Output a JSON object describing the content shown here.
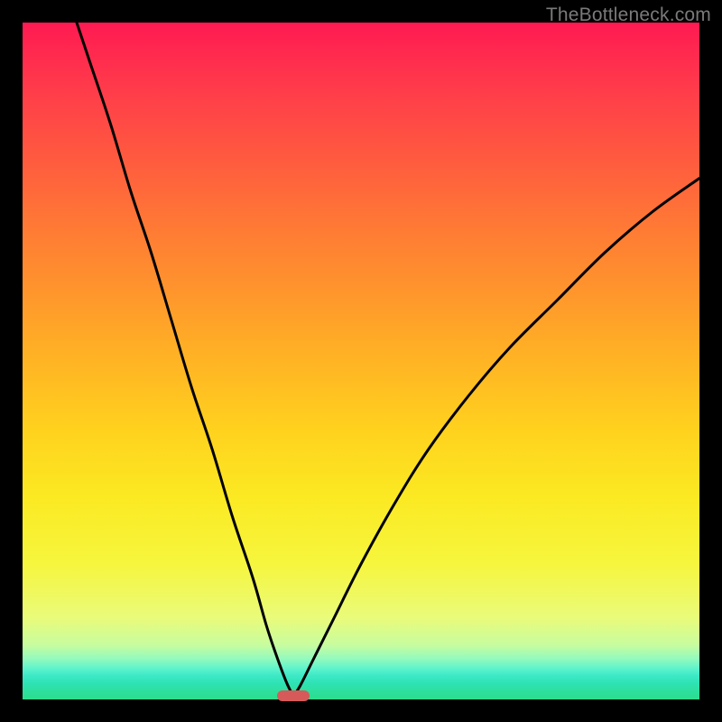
{
  "watermark": "TheBottleneck.com",
  "chart_data": {
    "type": "line",
    "title": "",
    "xlabel": "",
    "ylabel": "",
    "xlim": [
      0,
      100
    ],
    "ylim": [
      0,
      100
    ],
    "minimum_x": 40,
    "marker": {
      "x": 40,
      "y": 0.5,
      "color": "#d65a5a"
    },
    "series": [
      {
        "name": "left-branch",
        "x": [
          8,
          10,
          13,
          16,
          19,
          22,
          25,
          28,
          31,
          34,
          36,
          37.5,
          39,
          40
        ],
        "y": [
          100,
          94,
          85,
          75,
          66,
          56,
          46,
          37,
          27,
          18,
          11,
          6.5,
          2.5,
          0.5
        ]
      },
      {
        "name": "right-branch",
        "x": [
          40,
          41,
          43,
          46,
          50,
          55,
          60,
          66,
          72,
          79,
          86,
          93,
          100
        ],
        "y": [
          0.5,
          2,
          6,
          12,
          20,
          29,
          37,
          45,
          52,
          59,
          66,
          72,
          77
        ]
      }
    ],
    "background_gradient": {
      "top": "#ff1a52",
      "upper_mid": "#ff962c",
      "mid": "#ffd11e",
      "lower_mid": "#f6f63e",
      "bottom": "#2cdd8b"
    }
  }
}
